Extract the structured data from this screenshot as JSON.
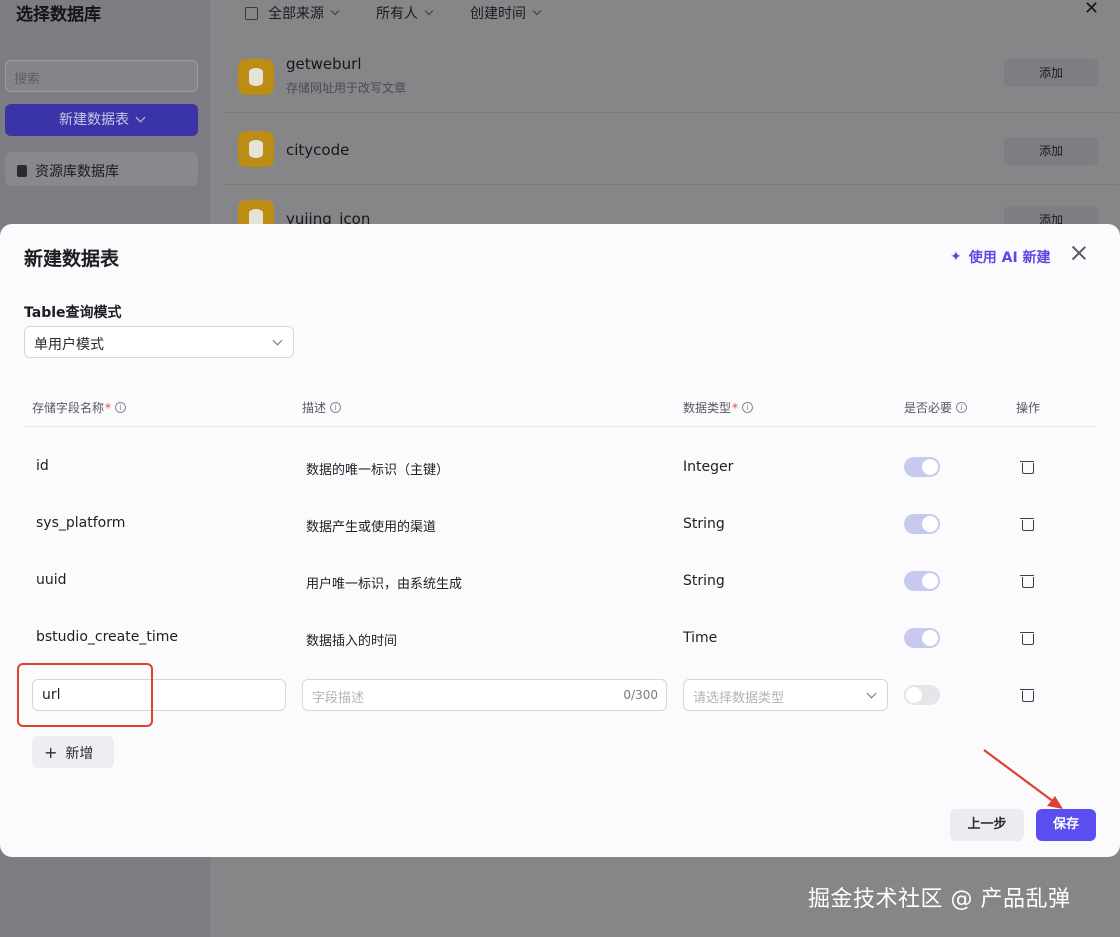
{
  "background": {
    "title": "选择数据库",
    "search_placeholder": "搜索",
    "new_table_button": "新建数据表",
    "resource_library": "资源库数据库",
    "filters": [
      "全部来源",
      "所有人",
      "创建时间"
    ],
    "databases": [
      {
        "name": "getweburl",
        "desc": "存储网址用于改写文章",
        "action": "添加"
      },
      {
        "name": "citycode",
        "desc": "",
        "action": "添加"
      },
      {
        "name": "yujing_icon",
        "desc": "",
        "action": "添加"
      }
    ],
    "close_glyph": "✕"
  },
  "modal": {
    "title": "新建数据表",
    "ai_button": "使用 AI 新建",
    "mode_label": "Table查询模式",
    "mode_value": "单用户模式",
    "columns": {
      "field": "存储字段名称",
      "desc": "描述",
      "type": "数据类型",
      "required": "是否必要",
      "action": "操作"
    },
    "rows": [
      {
        "field": "id",
        "desc": "数据的唯一标识（主键）",
        "type": "Integer",
        "required": true
      },
      {
        "field": "sys_platform",
        "desc": "数据产生或使用的渠道",
        "type": "String",
        "required": true
      },
      {
        "field": "uuid",
        "desc": "用户唯一标识，由系统生成",
        "type": "String",
        "required": true
      },
      {
        "field": "bstudio_create_time",
        "desc": "数据插入的时间",
        "type": "Time",
        "required": true
      }
    ],
    "new_row": {
      "field_value": "url",
      "desc_placeholder": "字段描述",
      "desc_counter": "0/300",
      "type_placeholder": "请选择数据类型",
      "required": false
    },
    "add_button": "新增",
    "prev_button": "上一步",
    "save_button": "保存"
  },
  "watermark": "掘金技术社区 @ 产品乱弹",
  "colors": {
    "primary": "#5b4ef0",
    "annotation_red": "#e0402d",
    "db_icon": "#e0a800"
  }
}
